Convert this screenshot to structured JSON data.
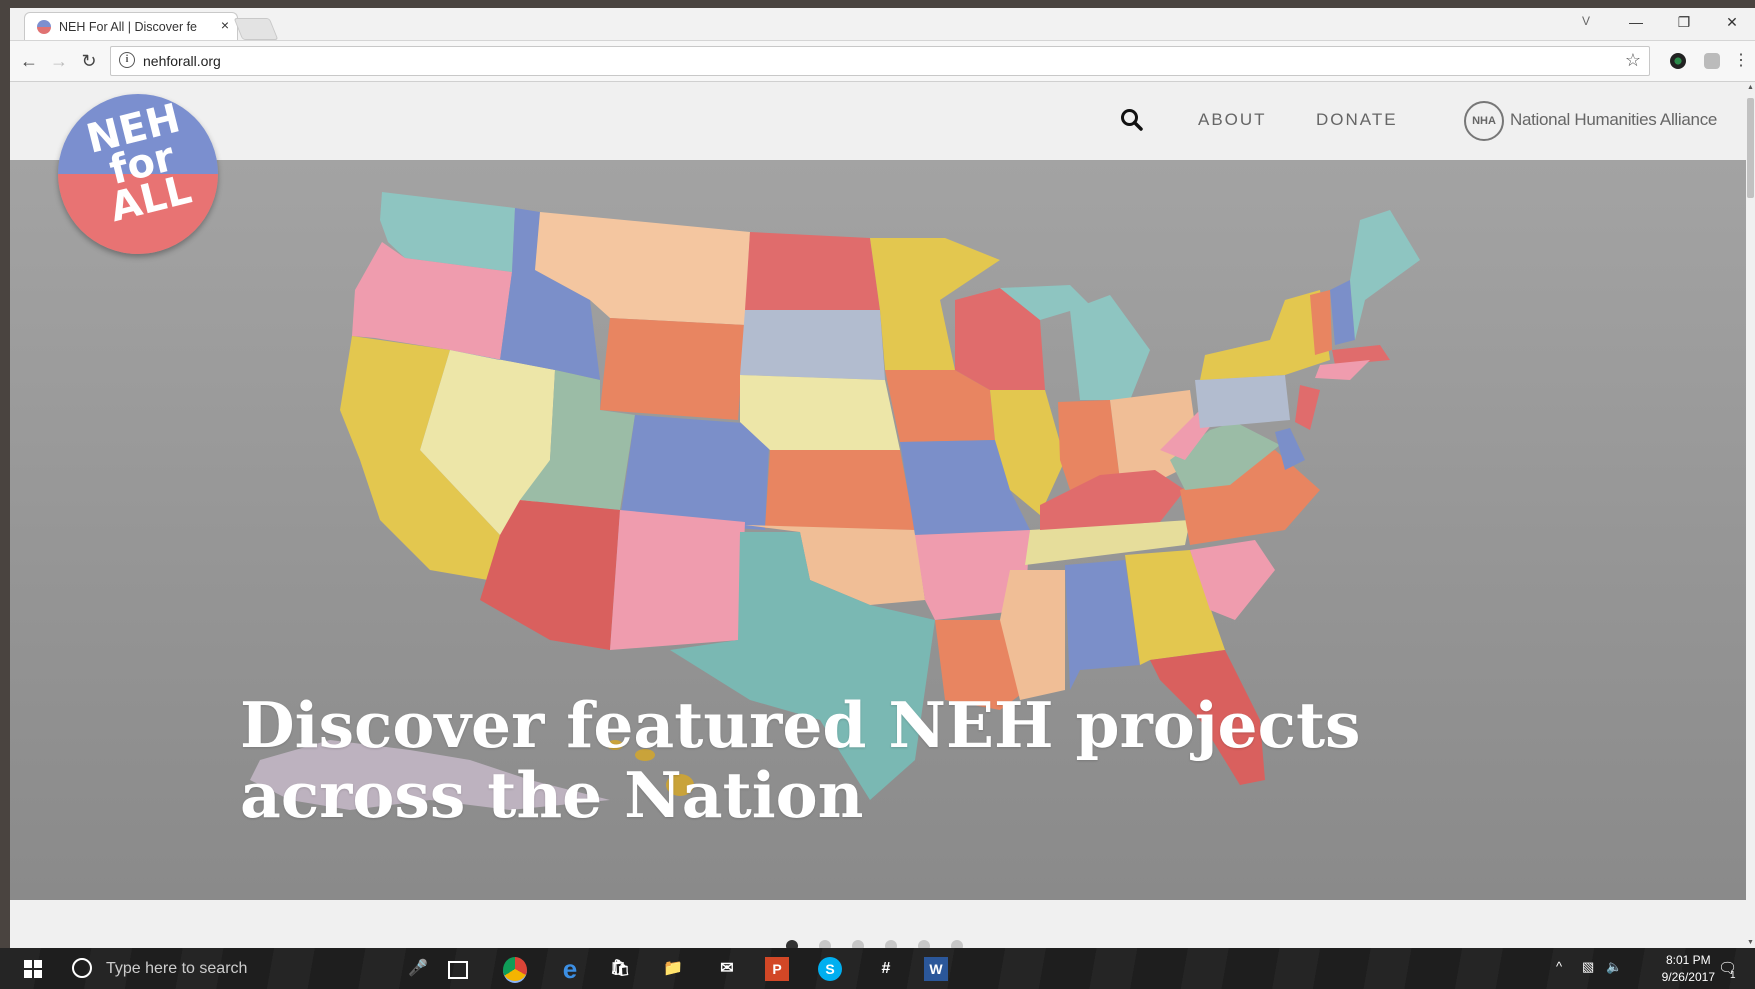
{
  "browser": {
    "tab_title": "NEH For All | Discover fe",
    "tab_close": "×",
    "url": "nehforall.org",
    "window_controls": [
      "—",
      "❐",
      "✕"
    ],
    "profile_glyph": "V"
  },
  "site": {
    "logo_lines": [
      "NEH",
      "for",
      "ALL"
    ],
    "nav": {
      "about": "ABOUT",
      "donate": "DONATE"
    },
    "partner_seal": "NHA",
    "partner_name": "National Humanities Alliance",
    "hero_title": "Discover featured NEH projects across the Nation",
    "carousel": {
      "count": 6,
      "active": 0
    }
  },
  "taskbar": {
    "search_placeholder": "Type here to search",
    "time": "8:01 PM",
    "date": "9/26/2017",
    "notification_count": "1"
  },
  "colors": {
    "logo_blue": "#7b8fcf",
    "logo_red": "#e87373",
    "hero_bg": "#9a9a9a"
  }
}
